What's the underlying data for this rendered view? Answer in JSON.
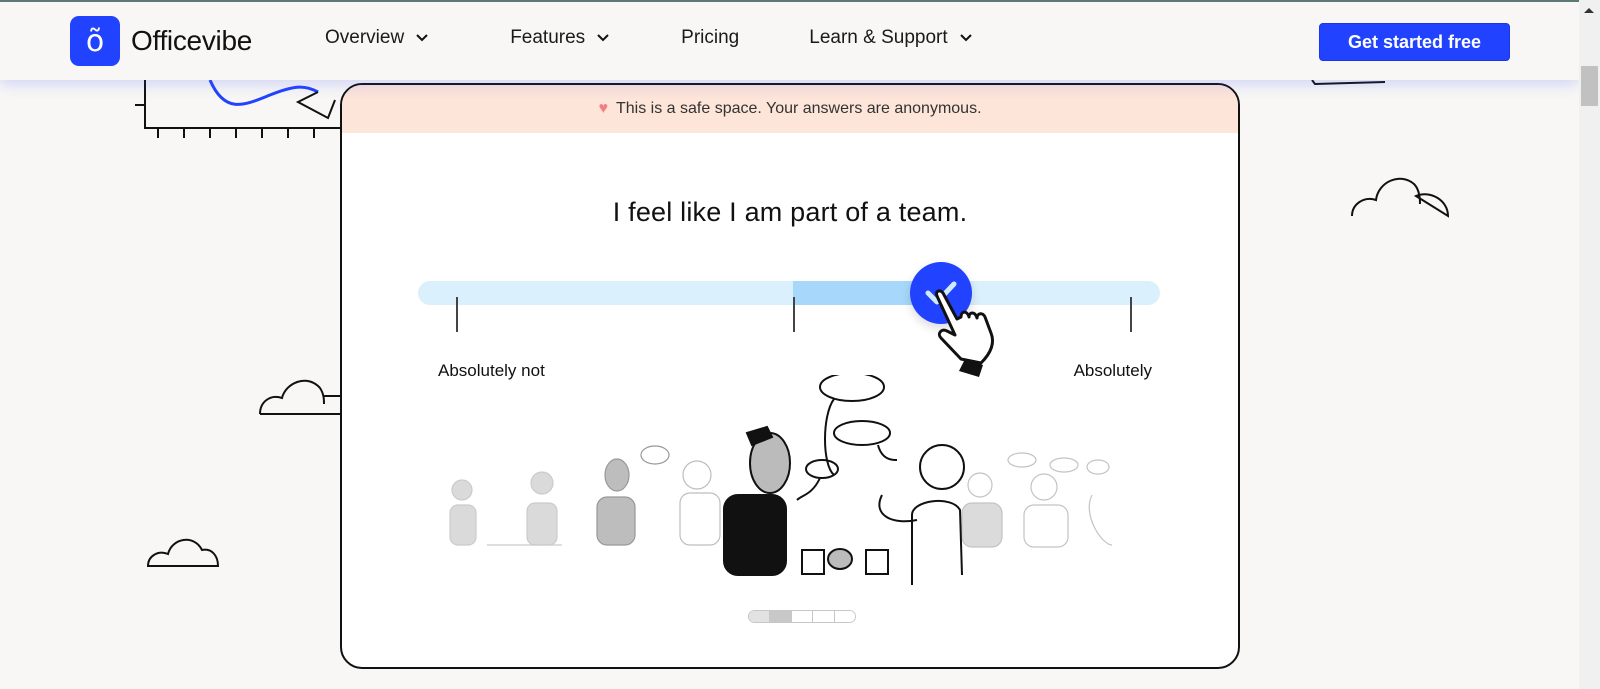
{
  "brand": {
    "name": "Officevibe",
    "logo_glyph": "õ",
    "accent_color": "#2143ff"
  },
  "nav": {
    "items": [
      {
        "label": "Overview",
        "has_dropdown": true,
        "icon": "chevron-down-icon"
      },
      {
        "label": "Features",
        "has_dropdown": true,
        "icon": "chevron-down-icon"
      },
      {
        "label": "Pricing",
        "has_dropdown": false
      },
      {
        "label": "Learn & Support",
        "has_dropdown": true,
        "icon": "chevron-down-icon"
      }
    ],
    "cta_label": "Get started free"
  },
  "survey": {
    "banner_icon": "heart-icon",
    "banner_text": "This is a safe space. Your answers are anonymous.",
    "banner_color": "#fde5d9",
    "question": "I feel like I am part of a team.",
    "slider": {
      "min_label": "Absolutely not",
      "max_label": "Absolutely",
      "value_fraction": 0.72,
      "midpoint_fraction": 0.5,
      "knob_icon": "check-icon",
      "cursor_icon": "hand-pointer-icon",
      "track_color": "#daf0fc",
      "fill_color": "#a7d8fb"
    },
    "pagination": {
      "total": 5,
      "current": 2
    }
  },
  "decorations": {
    "icons": [
      "line-chart-illustration",
      "cloud-icon",
      "cloud-icon",
      "cloud-icon",
      "team-illustration"
    ]
  }
}
